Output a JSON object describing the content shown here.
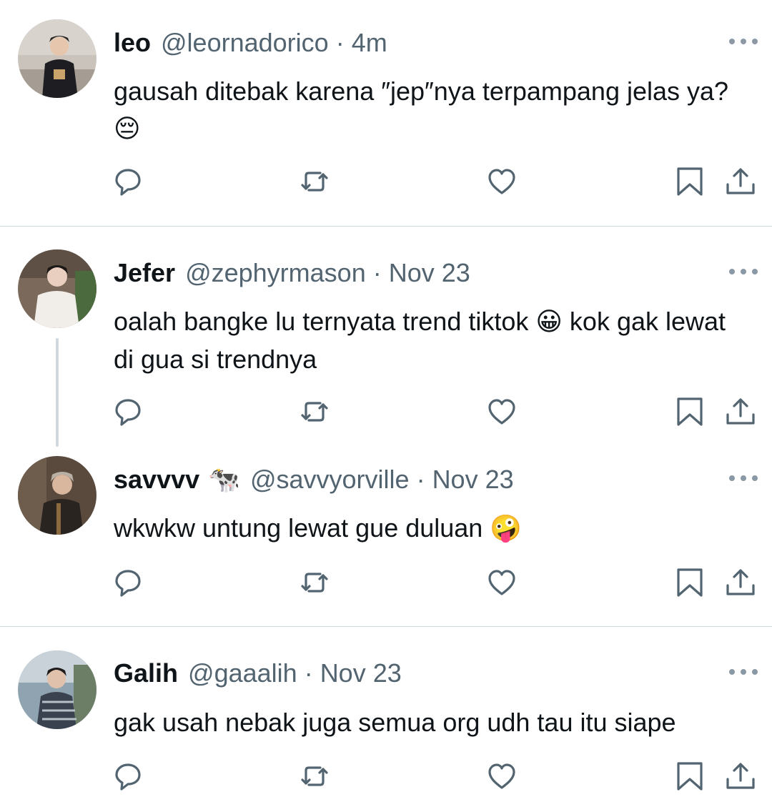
{
  "tweets": [
    {
      "name": "leo",
      "cow": "",
      "handle": "@leornadorico",
      "separator": "·",
      "time": "4m",
      "text": "gausah ditebak karena ″jep″nya terpampang jelas ya? ",
      "emoji": "😔",
      "avatar_colors": {
        "bg": "#c9c3bb",
        "fg": "#1e1e22",
        "skin": "#e6c6ad"
      }
    },
    {
      "name": "Jefer",
      "cow": "",
      "handle": "@zephyrmason",
      "separator": "·",
      "time": "Nov 23",
      "text": "oalah bangke lu ternyata trend tiktok ",
      "emoji": "😀",
      "text_after": " kok gak lewat di gua si trendnya",
      "avatar_colors": {
        "bg": "#7b6a5c",
        "fg": "#f1ede8",
        "skin": "#e9cfc0"
      }
    },
    {
      "name": "savvvv",
      "cow": "🐄",
      "handle": "@savvyorville",
      "separator": "·",
      "time": "Nov 23",
      "text": "wkwkw untung lewat gue duluan ",
      "emoji": "🤪",
      "avatar_colors": {
        "bg": "#5a4a3e",
        "fg": "#2a2420",
        "skin": "#d9b79e"
      }
    },
    {
      "name": "Galih",
      "cow": "",
      "handle": "@gaaalih",
      "separator": "·",
      "time": "Nov 23",
      "text": "gak usah nebak juga semua org udh tau itu siape",
      "emoji": "",
      "avatar_colors": {
        "bg": "#8fa3b0",
        "fg": "#3a4250",
        "skin": "#e0c2ac"
      }
    }
  ],
  "icons": [
    "reply-icon",
    "retweet-icon",
    "like-icon",
    "bookmark-icon",
    "share-icon"
  ],
  "colors": {
    "text": "#0f1419",
    "secondary": "#536471",
    "divider": "#cfd9de"
  }
}
